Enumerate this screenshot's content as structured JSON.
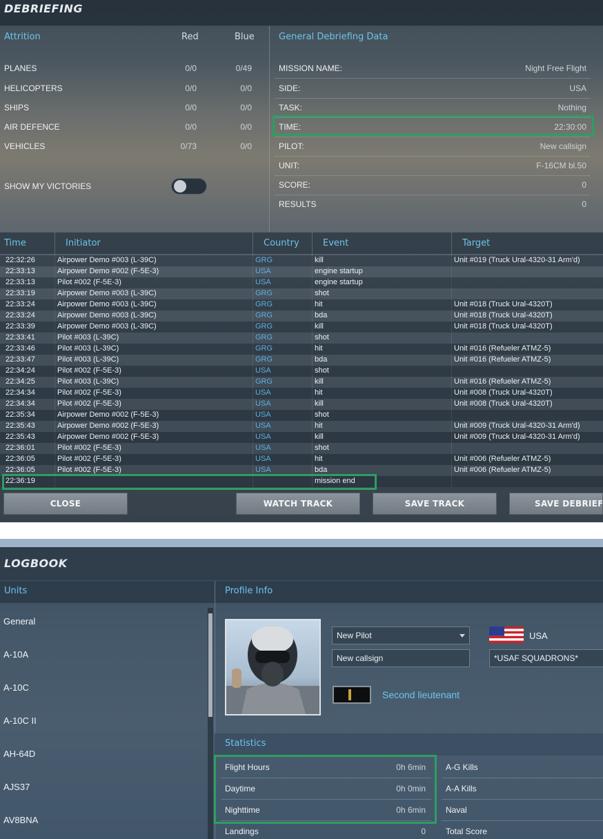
{
  "debriefing": {
    "title": "DEBRIEFING",
    "attrition": {
      "header": "Attrition",
      "col_red": "Red",
      "col_blue": "Blue",
      "rows": [
        {
          "label": "PLANES",
          "red": "0/0",
          "blue": "0/49"
        },
        {
          "label": "HELICOPTERS",
          "red": "0/0",
          "blue": "0/0"
        },
        {
          "label": "SHIPS",
          "red": "0/0",
          "blue": "0/0"
        },
        {
          "label": "AIR DEFENCE",
          "red": "0/0",
          "blue": "0/0"
        },
        {
          "label": "VEHICLES",
          "red": "0/73",
          "blue": "0/0"
        }
      ],
      "toggle_label": "SHOW MY VICTORIES",
      "toggle_on": false
    },
    "general": {
      "header": "General Debriefing Data",
      "rows": [
        {
          "label": "MISSION NAME:",
          "value": "Night Free Flight"
        },
        {
          "label": "SIDE:",
          "value": "USA"
        },
        {
          "label": "TASK:",
          "value": "Nothing"
        },
        {
          "label": "TIME:",
          "value": "22:30:00"
        },
        {
          "label": "PILOT:",
          "value": "New callsign"
        },
        {
          "label": "UNIT:",
          "value": "F-16CM bl.50"
        },
        {
          "label": "SCORE:",
          "value": "0"
        },
        {
          "label": "RESULTS",
          "value": "0"
        }
      ]
    },
    "events": {
      "columns": {
        "time": "Time",
        "initiator": "Initiator",
        "country": "Country",
        "event": "Event",
        "target": "Target"
      },
      "rows": [
        [
          "22:32:26",
          "Airpower Demo #003 (L-39C)",
          "GRG",
          "kill",
          "Unit #019 (Truck Ural-4320-31 Arm'd)"
        ],
        [
          "22:33:13",
          "Airpower Demo #002 (F-5E-3)",
          "USA",
          "engine startup",
          ""
        ],
        [
          "22:33:13",
          "Pilot #002 (F-5E-3)",
          "USA",
          "engine startup",
          ""
        ],
        [
          "22:33:19",
          "Airpower Demo #003 (L-39C)",
          "GRG",
          "shot",
          ""
        ],
        [
          "22:33:24",
          "Airpower Demo #003 (L-39C)",
          "GRG",
          "hit",
          "Unit #018 (Truck Ural-4320T)"
        ],
        [
          "22:33:24",
          "Airpower Demo #003 (L-39C)",
          "GRG",
          "bda",
          "Unit #018 (Truck Ural-4320T)"
        ],
        [
          "22:33:39",
          "Airpower Demo #003 (L-39C)",
          "GRG",
          "kill",
          "Unit #018 (Truck Ural-4320T)"
        ],
        [
          "22:33:41",
          "Pilot #003 (L-39C)",
          "GRG",
          "shot",
          ""
        ],
        [
          "22:33:46",
          "Pilot #003 (L-39C)",
          "GRG",
          "hit",
          "Unit #016 (Refueler ATMZ-5)"
        ],
        [
          "22:33:47",
          "Pilot #003 (L-39C)",
          "GRG",
          "bda",
          "Unit #016 (Refueler ATMZ-5)"
        ],
        [
          "22:34:24",
          "Pilot #002 (F-5E-3)",
          "USA",
          "shot",
          ""
        ],
        [
          "22:34:25",
          "Pilot #003 (L-39C)",
          "GRG",
          "kill",
          "Unit #016 (Refueler ATMZ-5)"
        ],
        [
          "22:34:34",
          "Pilot #002 (F-5E-3)",
          "USA",
          "hit",
          "Unit #008 (Truck Ural-4320T)"
        ],
        [
          "22:34:34",
          "Pilot #002 (F-5E-3)",
          "USA",
          "kill",
          "Unit #008 (Truck Ural-4320T)"
        ],
        [
          "22:35:34",
          "Airpower Demo #002 (F-5E-3)",
          "USA",
          "shot",
          ""
        ],
        [
          "22:35:43",
          "Airpower Demo #002 (F-5E-3)",
          "USA",
          "hit",
          "Unit #009 (Truck Ural-4320-31 Arm'd)"
        ],
        [
          "22:35:43",
          "Airpower Demo #002 (F-5E-3)",
          "USA",
          "kill",
          "Unit #009 (Truck Ural-4320-31 Arm'd)"
        ],
        [
          "22:36:01",
          "Pilot #002 (F-5E-3)",
          "USA",
          "shot",
          ""
        ],
        [
          "22:36:05",
          "Pilot #002 (F-5E-3)",
          "USA",
          "hit",
          "Unit #006 (Refueler ATMZ-5)"
        ],
        [
          "22:36:05",
          "Pilot #002 (F-5E-3)",
          "USA",
          "bda",
          "Unit #006 (Refueler ATMZ-5)"
        ],
        [
          "22:36:19",
          "",
          "",
          "mission end",
          ""
        ]
      ]
    },
    "buttons": {
      "close": "CLOSE",
      "watch_track": "WATCH TRACK",
      "save_track": "SAVE TRACK",
      "save_debriefing": "SAVE DEBRIEFING"
    },
    "highlight_color": "#2e9e62",
    "country_color": "#5fb0e0"
  },
  "logbook": {
    "title": "LOGBOOK",
    "units_header": "Units",
    "units": [
      "General",
      "A-10A",
      "A-10C",
      "A-10C II",
      "AH-64D",
      "AJS37",
      "AV8BNA"
    ],
    "profile_header": "Profile Info",
    "profile": {
      "pilot_select": "New Pilot",
      "callsign": "New callsign",
      "country": "USA",
      "squadron": "*USAF SQUADRONS*",
      "rank": "Second lieutenant"
    },
    "statistics_header": "Statistics",
    "stats_left": [
      {
        "label": "Flight Hours",
        "value": "0h 6min"
      },
      {
        "label": "Daytime",
        "value": "0h 0min"
      },
      {
        "label": "Nighttime",
        "value": "0h 6min"
      },
      {
        "label": "Landings",
        "value": "0"
      }
    ],
    "stats_right": [
      {
        "label": "A-G Kills"
      },
      {
        "label": "A-A Kills"
      },
      {
        "label": "Naval"
      },
      {
        "label": "Total Score"
      }
    ]
  }
}
